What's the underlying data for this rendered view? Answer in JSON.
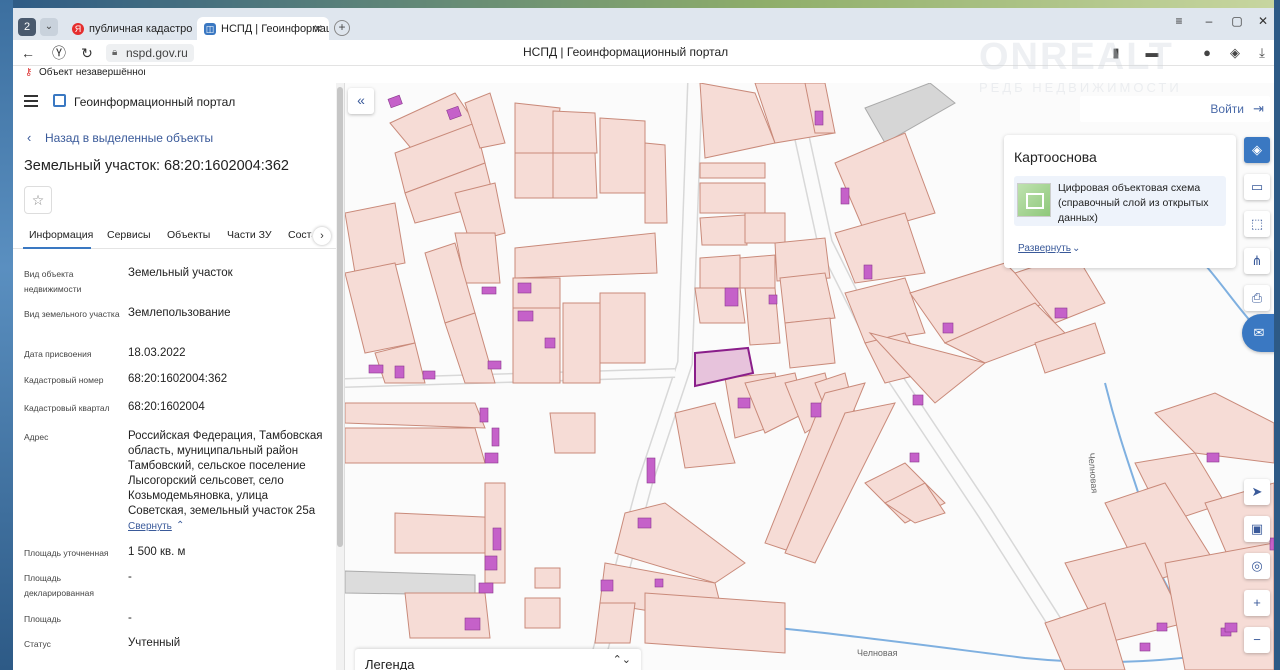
{
  "browser": {
    "tab_count": "2",
    "tabs": [
      {
        "label": "публичная кадастровая к",
        "favicon": "Я"
      },
      {
        "label": "НСПД | Геоинформационн",
        "favicon": "◫"
      }
    ],
    "url": "nspd.gov.ru",
    "page_title": "НСПД | Геоинформационный портал",
    "bookmark": "Объект незавершённого"
  },
  "panel": {
    "portal_name": "Геоинформационный портал",
    "back_link": "Назад в выделенные объекты",
    "object_title": "Земельный участок: 68:20:1602004:362",
    "tabs": [
      "Информация",
      "Сервисы",
      "Объекты",
      "Части ЗУ",
      "Состав"
    ],
    "rows": [
      {
        "label": "Вид объекта недвижимости",
        "value": "Земельный участок"
      },
      {
        "label": "Вид земельного участка",
        "value": "Землепользование"
      },
      {
        "label": "Дата присвоения",
        "value": "18.03.2022"
      },
      {
        "label": "Кадастровый номер",
        "value": "68:20:1602004:362"
      },
      {
        "label": "Кадастровый квартал",
        "value": "68:20:1602004"
      },
      {
        "label": "Адрес",
        "value": "Российская Федерация, Тамбовская область, муниципальный район Тамбовский, сельское поселение Лысогорский сельсовет, село Козьмодемьяновка, улица Советская, земельный участок 25а"
      },
      {
        "label": "Площадь уточненная",
        "value": "1 500 кв. м"
      },
      {
        "label": "Площадь декларированная",
        "value": "-"
      },
      {
        "label": "Площадь",
        "value": "-"
      },
      {
        "label": "Статус",
        "value": "Учтенный"
      }
    ],
    "collapse_link": "Свернуть"
  },
  "map": {
    "login": "Войти",
    "basemap_title": "Картооснова",
    "basemap_item": "Цифровая объектовая схема (справочный слой из открытых данных)",
    "expand_link": "Развернуть",
    "legend_title": "Легенда",
    "street_labels": [
      "Челновая",
      "Челновая"
    ]
  },
  "watermark": {
    "main": "ONREALT",
    "sub": "РЕДБ НЕДВИЖИМОСТИ"
  },
  "colors": {
    "parcel_fill": "#f6dcd6",
    "parcel_stroke": "#c98a7a",
    "building": "#c561c9",
    "selected_fill": "#e7c3dc",
    "selected_stroke": "#8a1e8a",
    "accent": "#3a78c2",
    "river": "#7fb0e0"
  }
}
